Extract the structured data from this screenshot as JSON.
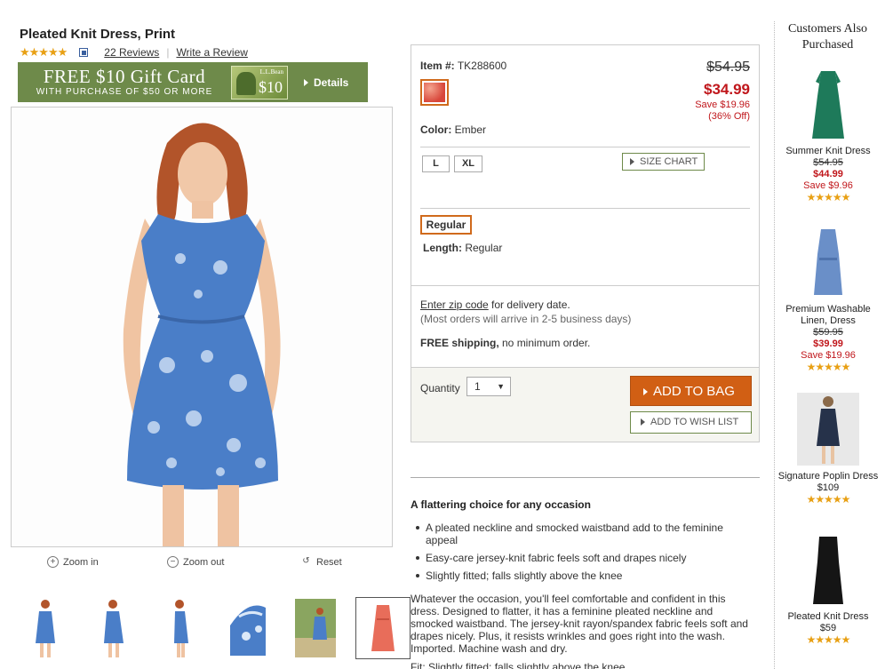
{
  "product": {
    "title": "Pleated Knit Dress, Print",
    "stars": "★★★★★",
    "reviews_link": "22 Reviews",
    "write_review": "Write a Review"
  },
  "promo": {
    "line1": "FREE $10 Gift Card",
    "line2": "WITH PURCHASE OF $50 OR MORE",
    "card_brand": "L.L.Bean",
    "card_amount": "$10",
    "details": "Details"
  },
  "zoom": {
    "zoom_in": "Zoom in",
    "zoom_out": "Zoom out",
    "reset": "Reset"
  },
  "buybox": {
    "item_label": "Item #:",
    "item_number": "TK288600",
    "price_old": "$54.95",
    "price_new": "$34.99",
    "save_amount": "Save $19.96",
    "save_pct": "(36% Off)",
    "color_label": "Color:",
    "color_value": "Ember",
    "sizes": [
      "L",
      "XL"
    ],
    "size_chart": "SIZE CHART",
    "length_option": "Regular",
    "length_label": "Length:",
    "length_value": "Regular",
    "zip_link": "Enter zip code",
    "zip_suffix": " for delivery date.",
    "delivery_note": "(Most orders will arrive in 2-5 business days)",
    "shipping_bold": "FREE shipping,",
    "shipping_rest": " no minimum order.",
    "quantity_label": "Quantity",
    "quantity_value": "1",
    "add_to_bag": "ADD TO BAG",
    "add_to_wish": "ADD TO WISH LIST"
  },
  "description": {
    "heading": "A flattering choice for any occasion",
    "bullets": [
      "A pleated neckline and smocked waistband add to the feminine appeal",
      "Easy-care jersey-knit fabric feels soft and drapes nicely",
      "Slightly fitted; falls slightly above the knee"
    ],
    "body": "Whatever the occasion, you'll feel comfortable and confident in this dress. Designed to flatter, it has a feminine pleated neckline and smocked waistband. The jersey-knit rayon/spandex fabric feels soft and drapes nicely. Plus, it resists wrinkles and goes right into the wash. Imported. Machine wash and dry.",
    "more": "Fit: Slightly fitted; falls slightly above the knee."
  },
  "sidebar": {
    "heading": "Customers Also Purchased",
    "items": [
      {
        "name": "Summer Knit Dress",
        "old": "$54.95",
        "new": "$44.99",
        "save": "Save $9.96",
        "stars": "★★★★★"
      },
      {
        "name": "Premium Washable Linen, Dress",
        "old": "$59.95",
        "new": "$39.99",
        "save": "Save $19.96",
        "stars": "★★★★★"
      },
      {
        "name": "Signature Poplin Dress",
        "price": "$109",
        "stars": "★★★★★"
      },
      {
        "name": "Pleated Knit Dress",
        "price": "$59",
        "stars": "★★★★★"
      }
    ]
  },
  "colors": {
    "accent_orange": "#d15f14",
    "sale_red": "#c0161b",
    "promo_green": "#6e8a4a",
    "dress_blue": "#4a7ec8"
  }
}
